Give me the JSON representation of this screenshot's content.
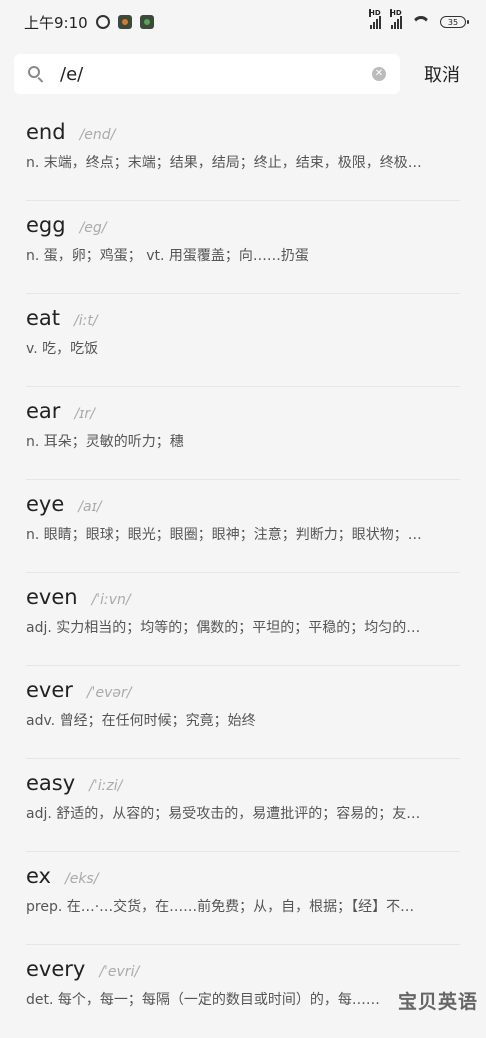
{
  "status": {
    "time": "上午9:10",
    "hd1": "HD",
    "hd2": "HD",
    "battery": "35"
  },
  "search": {
    "value": "/e/",
    "cancel_label": "取消"
  },
  "results": [
    {
      "word": "end",
      "phon": "/end/",
      "def": "n. 末端，终点；末端；结果，结局；终止，结束，极限，终极…"
    },
    {
      "word": "egg",
      "phon": "/eg/",
      "def": "n. 蛋，卵；鸡蛋； vt. 用蛋覆盖；向……扔蛋"
    },
    {
      "word": "eat",
      "phon": "/iːt/",
      "def": "v. 吃，吃饭"
    },
    {
      "word": "ear",
      "phon": "/ɪr/",
      "def": "n. 耳朵；灵敏的听力；穗"
    },
    {
      "word": "eye",
      "phon": "/aɪ/",
      "def": "n. 眼睛；眼球；眼光；眼圈；眼神；注意；判断力；眼状物；…"
    },
    {
      "word": "even",
      "phon": "/ˈiːvn/",
      "def": "adj. 实力相当的；均等的；偶数的；平坦的；平稳的；均匀的…"
    },
    {
      "word": "ever",
      "phon": "/ˈevər/",
      "def": "adv. 曾经；在任何时候；究竟；始终"
    },
    {
      "word": "easy",
      "phon": "/ˈiːzi/",
      "def": "adj. 舒适的，从容的；易受攻击的，易遭批评的；容易的；友…"
    },
    {
      "word": "ex",
      "phon": "/eks/",
      "def": "prep. 在…·…交货，在……前免费；从，自，根据；【经】不…"
    },
    {
      "word": "every",
      "phon": "/ˈevri/",
      "def": "det. 每个，每一；每隔（一定的数目或时间）的，每……"
    }
  ],
  "watermark": "宝贝英语"
}
